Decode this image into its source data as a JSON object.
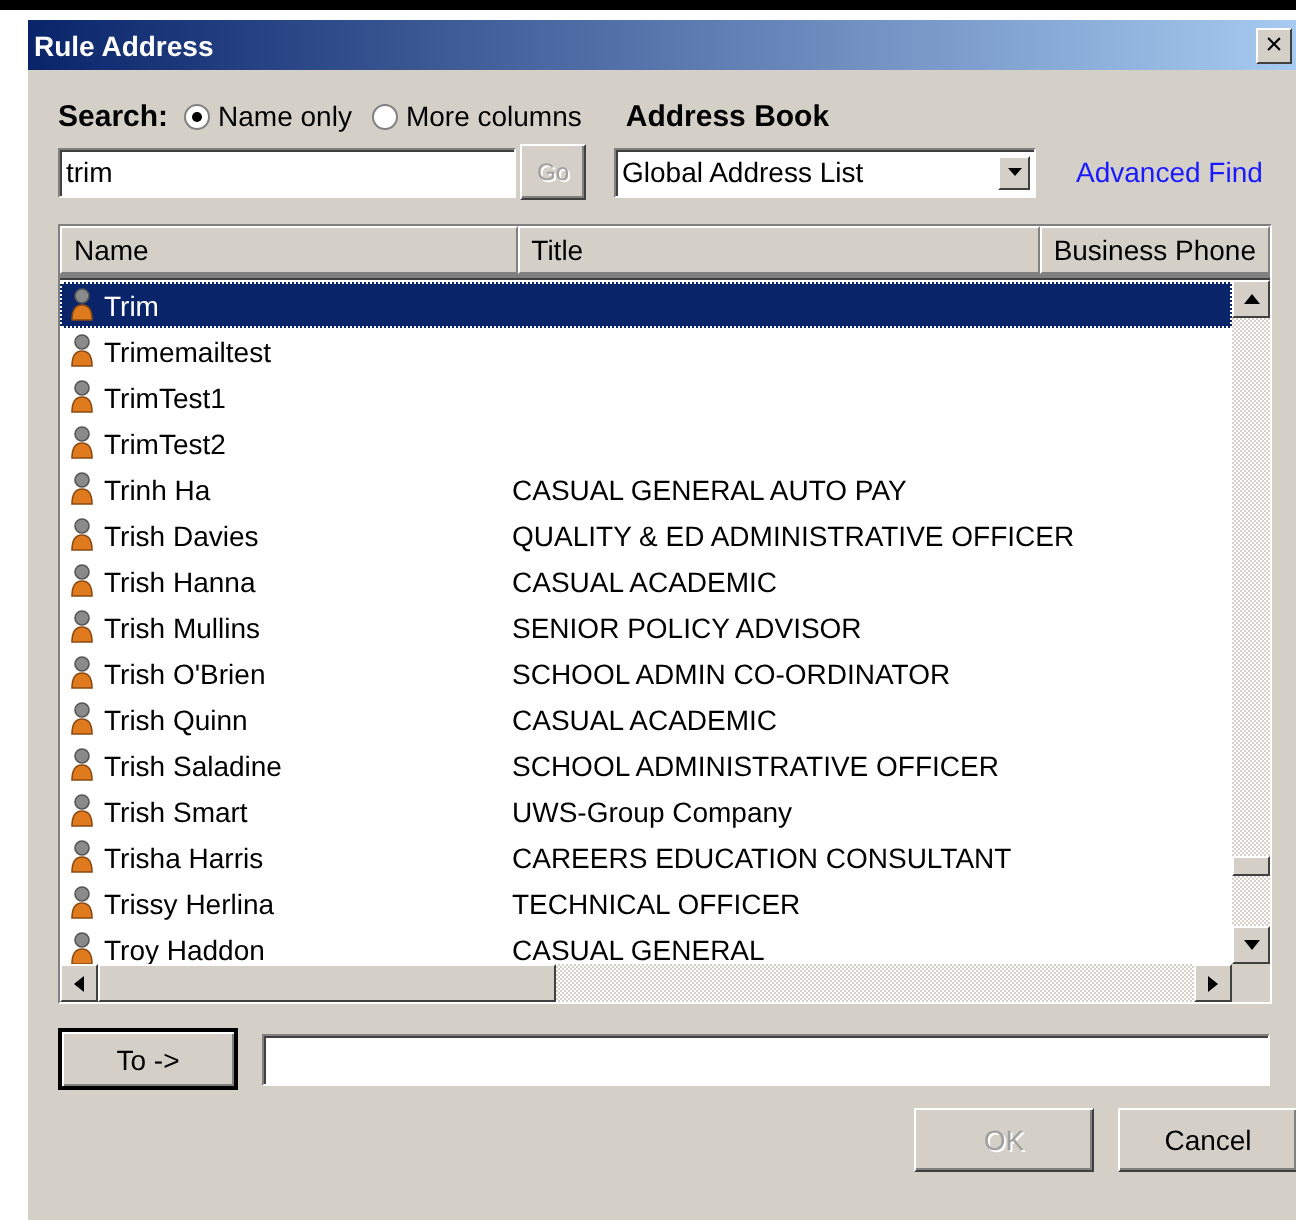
{
  "window": {
    "title": "Rule Address",
    "close": "×"
  },
  "search": {
    "label": "Search:",
    "options": [
      {
        "label": "Name only",
        "selected": true
      },
      {
        "label": "More columns",
        "selected": false
      }
    ],
    "value": "trim",
    "go": {
      "label": "Go",
      "disabled": true
    }
  },
  "address_book": {
    "label": "Address Book",
    "value": "Global Address List",
    "advanced_find": "Advanced Find"
  },
  "table": {
    "columns": [
      "Name",
      "Title",
      "Business Phone"
    ],
    "rows": [
      {
        "name": "Trim",
        "title": "",
        "selected": true
      },
      {
        "name": "Trimemailtest",
        "title": "",
        "selected": false
      },
      {
        "name": "TrimTest1",
        "title": "",
        "selected": false
      },
      {
        "name": "TrimTest2",
        "title": "",
        "selected": false
      },
      {
        "name": "Trinh Ha",
        "title": "CASUAL GENERAL AUTO PAY",
        "selected": false
      },
      {
        "name": "Trish Davies",
        "title": "QUALITY & ED ADMINISTRATIVE OFFICER",
        "selected": false
      },
      {
        "name": "Trish Hanna",
        "title": "CASUAL ACADEMIC",
        "selected": false
      },
      {
        "name": "Trish Mullins",
        "title": "SENIOR POLICY ADVISOR",
        "selected": false
      },
      {
        "name": "Trish O'Brien",
        "title": "SCHOOL ADMIN CO-ORDINATOR",
        "selected": false
      },
      {
        "name": "Trish Quinn",
        "title": "CASUAL ACADEMIC",
        "selected": false
      },
      {
        "name": "Trish Saladine",
        "title": "SCHOOL ADMINISTRATIVE OFFICER",
        "selected": false
      },
      {
        "name": "Trish Smart",
        "title": "UWS-Group Company",
        "selected": false
      },
      {
        "name": "Trisha Harris",
        "title": "CAREERS EDUCATION CONSULTANT",
        "selected": false
      },
      {
        "name": "Trissy Herlina",
        "title": "TECHNICAL OFFICER",
        "selected": false
      },
      {
        "name": "Troy Haddon",
        "title": "CASUAL GENERAL",
        "selected": false
      }
    ]
  },
  "to": {
    "label": "To ->"
  },
  "buttons": [
    {
      "label": "OK",
      "disabled": true
    },
    {
      "label": "Cancel",
      "disabled": false
    }
  ]
}
